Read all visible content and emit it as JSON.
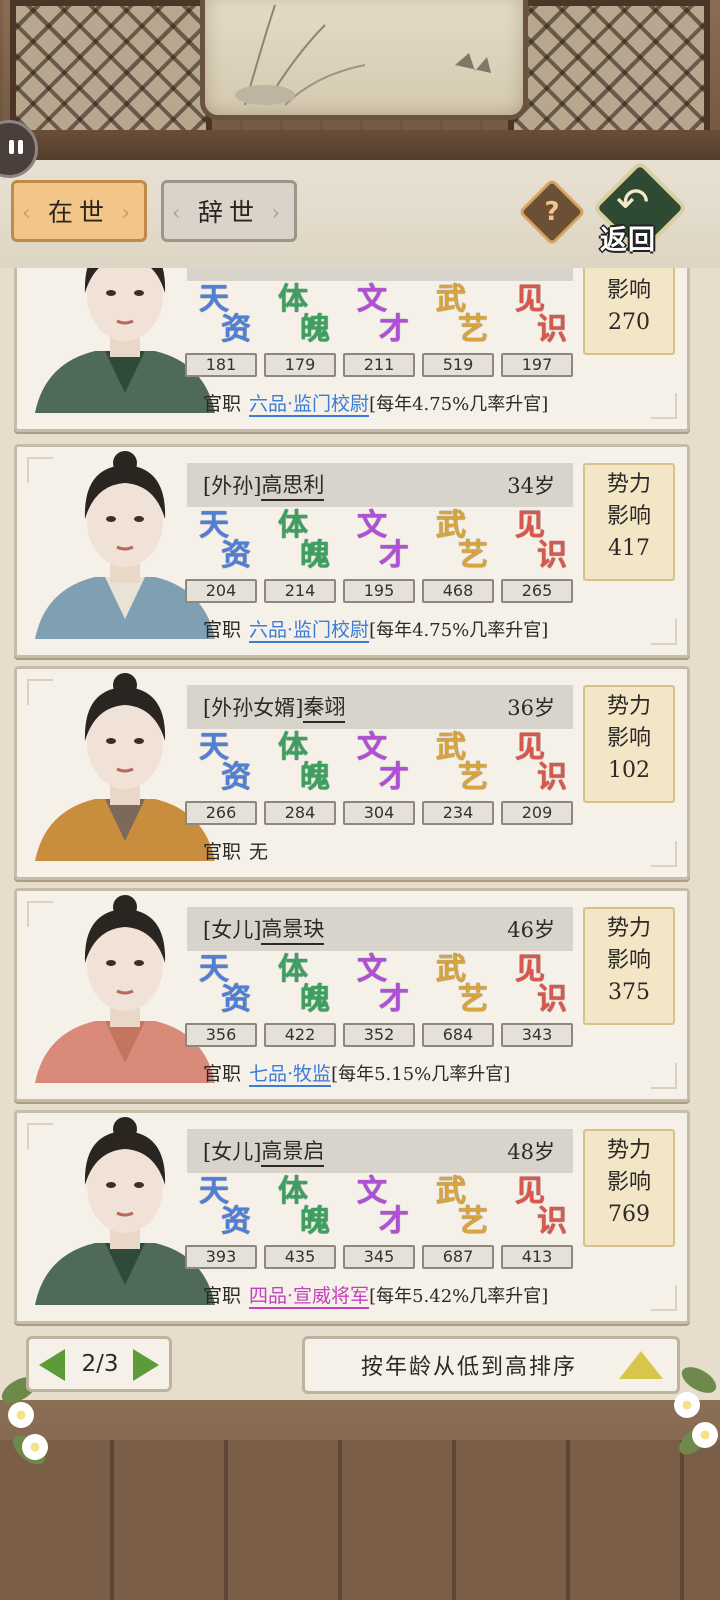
{
  "tabs": {
    "alive": "在世",
    "dead": "辞世"
  },
  "help_label": "?",
  "back_label": "返回",
  "stat_labels": [
    {
      "g1": "天",
      "g2": "资",
      "color": "#4f7fd9"
    },
    {
      "g1": "体",
      "g2": "魄",
      "color": "#3ea060"
    },
    {
      "g1": "文",
      "g2": "才",
      "color": "#b24fd8"
    },
    {
      "g1": "武",
      "g2": "艺",
      "color": "#d9a43e"
    },
    {
      "g1": "见",
      "g2": "识",
      "color": "#d9584e"
    }
  ],
  "power_label": {
    "line1": "势力",
    "line2": "影响"
  },
  "office_label": "官职",
  "cards": [
    {
      "relation": "",
      "name": "",
      "age": "",
      "stats": [
        "181",
        "179",
        "211",
        "519",
        "197"
      ],
      "influence": "270",
      "rank": "六品·监门校尉",
      "promotion": "[每年4.75%几率升官]"
    },
    {
      "relation": "[外孙]",
      "name": "高思利",
      "age": "34岁",
      "stats": [
        "204",
        "214",
        "195",
        "468",
        "265"
      ],
      "influence": "417",
      "rank": "六品·监门校尉",
      "promotion": "[每年4.75%几率升官]"
    },
    {
      "relation": "[外孙女婿]",
      "name": "秦翊",
      "age": "36岁",
      "stats": [
        "266",
        "284",
        "304",
        "234",
        "209"
      ],
      "influence": "102",
      "rank": "无",
      "promotion": ""
    },
    {
      "relation": "[女儿]",
      "name": "高景玦",
      "age": "46岁",
      "stats": [
        "356",
        "422",
        "352",
        "684",
        "343"
      ],
      "influence": "375",
      "rank": "七品·牧监",
      "promotion": "[每年5.15%几率升官]"
    },
    {
      "relation": "[女儿]",
      "name": "高景启",
      "age": "48岁",
      "stats": [
        "393",
        "435",
        "345",
        "687",
        "413"
      ],
      "influence": "769",
      "rank": "四品·宣威将军",
      "promotion": "[每年5.42%几率升官]"
    }
  ],
  "pager": {
    "text": "2/3"
  },
  "sort_label": "按年龄从低到高排序"
}
